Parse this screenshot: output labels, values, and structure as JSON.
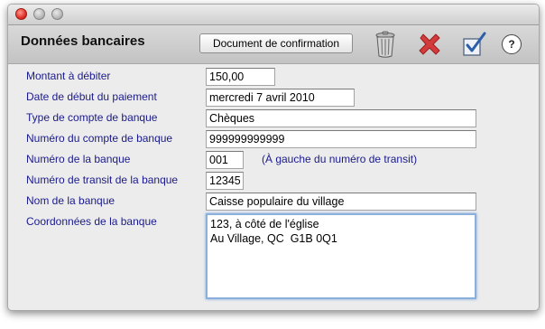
{
  "window": {
    "header_title": "Données bancaires",
    "confirm_doc_button": "Document de confirmation",
    "icons": [
      "trash-icon",
      "delete-x-icon",
      "checkmark-icon",
      "help-icon"
    ],
    "help_label": "?"
  },
  "form": {
    "fields": [
      {
        "label": "Montant à débiter",
        "value": "150,00"
      },
      {
        "label": "Date de début du paiement",
        "value": "mercredi 7 avril 2010"
      },
      {
        "label": "Type de compte de banque",
        "value": "Chèques"
      },
      {
        "label": "Numéro du compte de banque",
        "value": "999999999999"
      },
      {
        "label": "Numéro de la banque",
        "value": "001",
        "hint": "(À gauche du numéro de transit)"
      },
      {
        "label": "Numéro de transit de la banque",
        "value": "12345"
      },
      {
        "label": "Nom de la banque",
        "value": "Caisse populaire du village"
      },
      {
        "label": "Coordonnées de la banque",
        "value": "123, à côté de l'église\nAu Village, QC  G1B 0Q1"
      }
    ]
  },
  "colors": {
    "label": "#1a1a8c",
    "delete_red": "#d33c3c",
    "focus_ring": "#8bb0dc"
  }
}
